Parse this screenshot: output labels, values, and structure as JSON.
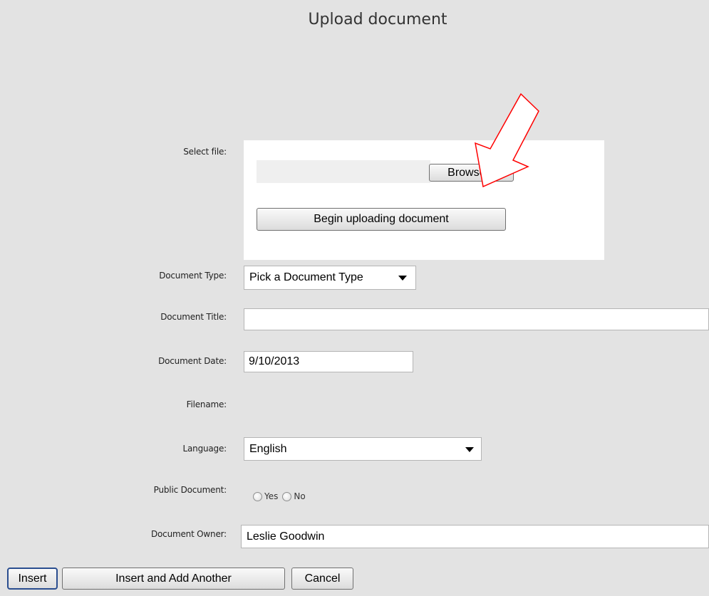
{
  "page": {
    "title": "Upload document"
  },
  "labels": {
    "select_file": "Select file:",
    "document_type": "Document Type:",
    "document_title": "Document Title:",
    "document_date": "Document Date:",
    "filename": "Filename:",
    "language": "Language:",
    "public_document": "Public Document:",
    "document_owner": "Document Owner:"
  },
  "upload": {
    "file_value": "",
    "browse_label": "Browse...",
    "begin_label": "Begin uploading document"
  },
  "fields": {
    "document_type": "Pick a Document Type",
    "document_title": "",
    "document_date": "9/10/2013",
    "filename": "",
    "language": "English",
    "public_yes": "Yes",
    "public_no": "No",
    "document_owner": "Leslie Goodwin"
  },
  "actions": {
    "insert": "Insert",
    "insert_add": "Insert and Add Another",
    "cancel": "Cancel"
  },
  "annotation": {
    "arrow_color": "#ff0000"
  }
}
